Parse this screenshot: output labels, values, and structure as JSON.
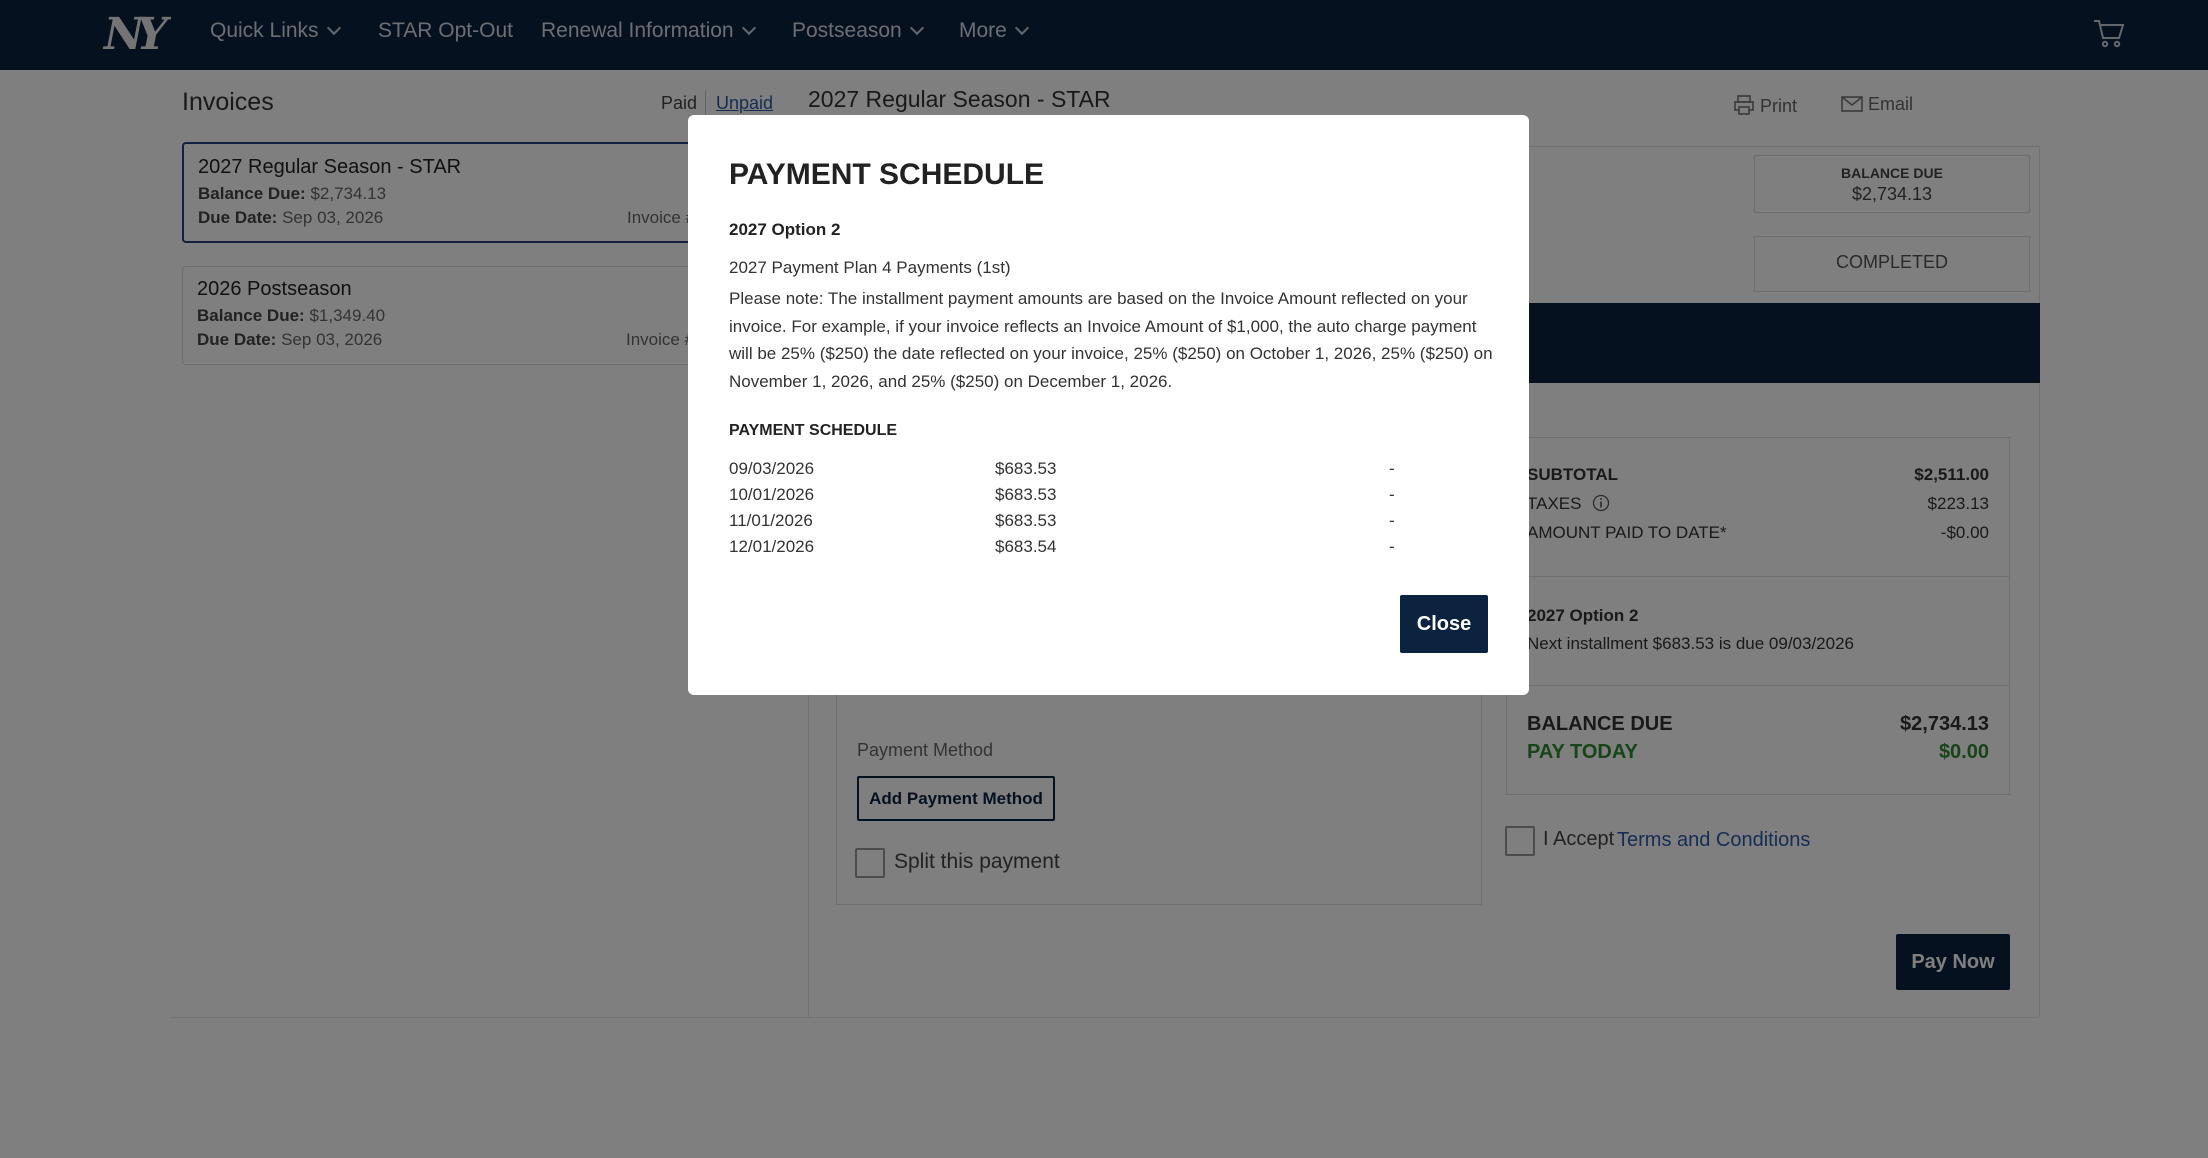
{
  "nav": {
    "logo_text": "NY",
    "items": [
      {
        "label": "Quick Links",
        "has_dropdown": true
      },
      {
        "label": "STAR Opt-Out",
        "has_dropdown": false
      },
      {
        "label": "Renewal Information",
        "has_dropdown": true
      },
      {
        "label": "Postseason",
        "has_dropdown": true
      },
      {
        "label": "More",
        "has_dropdown": true
      }
    ],
    "cart_icon": "cart-icon"
  },
  "invoices": {
    "title": "Invoices",
    "filter_paid": "Paid",
    "filter_unpaid": "Unpaid",
    "cards": [
      {
        "title": "2027 Regular Season - STAR",
        "balance_label": "Balance Due:",
        "balance_value": "$2,734.13",
        "due_label": "Due Date:",
        "due_value": "Sep 03, 2026",
        "invoice_label": "Invoice #"
      },
      {
        "title": "2026 Postseason",
        "balance_label": "Balance Due:",
        "balance_value": "$1,349.40",
        "due_label": "Due Date:",
        "due_value": "Sep 03, 2026",
        "invoice_label": "Invoice #"
      }
    ]
  },
  "detail": {
    "title": "2027 Regular Season - STAR",
    "print_label": "Print",
    "email_label": "Email",
    "balance_due_label": "BALANCE DUE",
    "balance_due_value": "$2,734.13",
    "status": "COMPLETED"
  },
  "summary": {
    "subtotal_label": "SUBTOTAL",
    "subtotal_value": "$2,511.00",
    "taxes_label": "TAXES",
    "taxes_value": "$223.13",
    "paid_label": "AMOUNT PAID TO DATE*",
    "paid_value": "-$0.00",
    "plan_name": "2027 Option 2",
    "plan_next": "Next installment $683.53 is due 09/03/2026",
    "balance_label": "BALANCE DUE",
    "balance_value": "$2,734.13",
    "pay_today_label": "PAY TODAY",
    "pay_today_value": "$0.00"
  },
  "payment": {
    "method_label": "Payment Method",
    "add_button": "Add Payment Method",
    "split_label": "Split this payment",
    "accept_label": "I Accept",
    "terms_link": "Terms and Conditions",
    "pay_button": "Pay Now"
  },
  "modal": {
    "title": "PAYMENT SCHEDULE",
    "option": "2027 Option 2",
    "plan": "2027 Payment Plan 4 Payments (1st)",
    "note": "Please note: The installment payment amounts are based on the Invoice Amount reflected on your invoice. For example, if your invoice reflects an Invoice Amount of $1,000, the auto charge payment will be 25% ($250) the date reflected on your invoice, 25% ($250) on October 1, 2026, 25% ($250) on November 1, 2026, and 25% ($250) on December 1, 2026.",
    "schedule_heading": "PAYMENT SCHEDULE",
    "schedule": [
      {
        "date": "09/03/2026",
        "amount": "$683.53",
        "status": "-"
      },
      {
        "date": "10/01/2026",
        "amount": "$683.53",
        "status": "-"
      },
      {
        "date": "11/01/2026",
        "amount": "$683.53",
        "status": "-"
      },
      {
        "date": "12/01/2026",
        "amount": "$683.54",
        "status": "-"
      }
    ],
    "close_button": "Close"
  },
  "colors": {
    "navy": "#0c2340",
    "link_blue": "#2d5ba6",
    "green": "#2e8b2e",
    "overlay": "rgba(0,0,0,0.5)"
  }
}
